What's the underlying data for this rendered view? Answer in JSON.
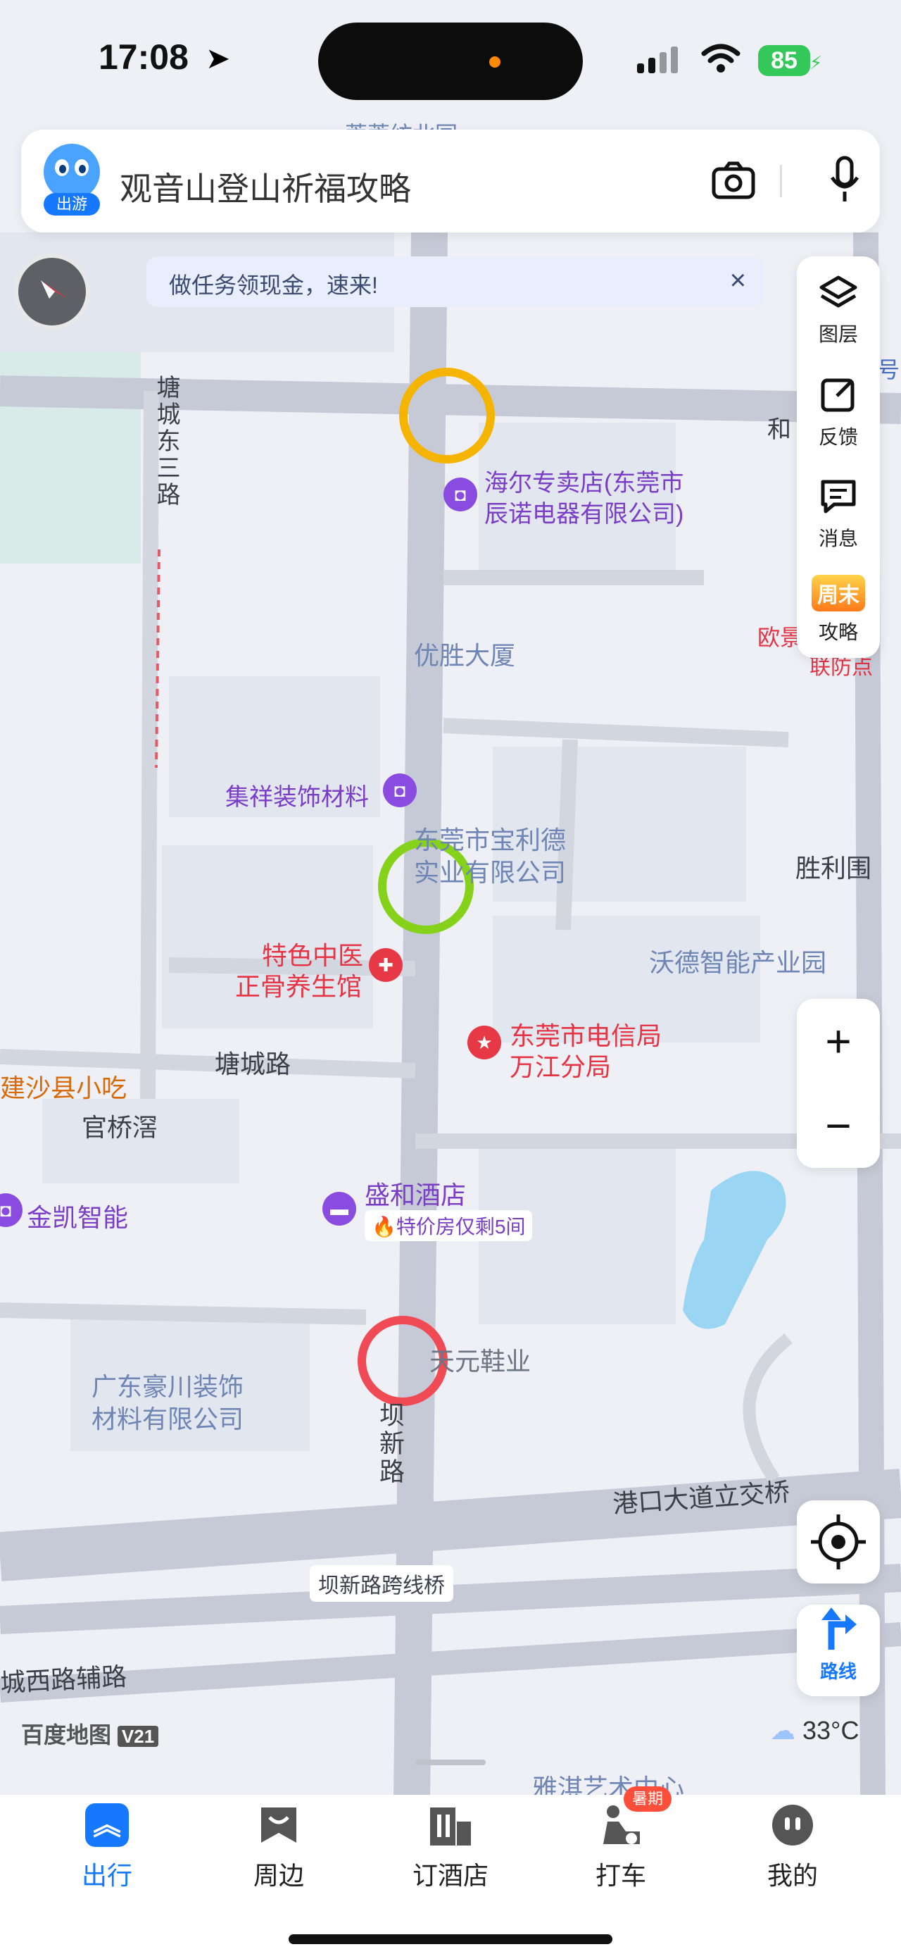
{
  "status_bar": {
    "time": "17:08",
    "battery": "85"
  },
  "search": {
    "badge": "出游",
    "query": "观音山登山祈福攻略"
  },
  "banner": {
    "text": "做任务领现金，速来!",
    "close": "×"
  },
  "panel": {
    "layers": "图层",
    "feedback": "反馈",
    "messages": "消息",
    "guide_badge": "周末",
    "guide": "攻略"
  },
  "zoom": {
    "plus": "+",
    "minus": "−"
  },
  "route": {
    "label": "路线"
  },
  "map": {
    "roads": {
      "tangcheng_east3": "塘城东三路",
      "tangcheng": "塘城路",
      "baxin": "坝新路",
      "gangkou": "港口大道立交桥",
      "baxin_bridge": "坝新路跨线桥",
      "chengxi": "城西路辅路"
    },
    "pois": {
      "haier": "海尔专卖店(东莞市辰诺电器有限公司)",
      "haier_line1": "海尔专卖店(东莞市",
      "haier_line2": "辰诺电器有限公司)",
      "yousheng": "优胜大厦",
      "jixiang": "集祥装饰材料",
      "baolide_line1": "东莞市宝利德",
      "baolide_line2": "实业有限公司",
      "tcm_line1": "特色中医",
      "tcm_line2": "正骨养生馆",
      "telecom_line1": "东莞市电信局",
      "telecom_line2": "万江分局",
      "wode": "沃德智能产业园",
      "shengli": "胜利围",
      "shaxian": "建沙县小吃",
      "guanqiao": "官桥滘",
      "jinkai": "金凯智能",
      "shenghe": "盛和酒店",
      "shenghe_deal": "特价房仅剩5间",
      "tianyuan": "天元鞋业",
      "haochuan_line1": "广东豪川装饰",
      "haochuan_line2": "材料有限公司",
      "ouo": "欧景",
      "lianfang": "联防点",
      "he": "和",
      "hao": "号",
      "yaqi": "雅淇艺术中心",
      "top_fragment": "莞莞纺北园"
    },
    "markers": {
      "yellow": "#f5b400",
      "green": "#86d21a",
      "red": "#f04b55"
    },
    "brand": "百度地图",
    "version": "V21",
    "temperature": "33°C"
  },
  "tabs": [
    {
      "label": "出行",
      "active": true
    },
    {
      "label": "周边",
      "active": false
    },
    {
      "label": "订酒店",
      "active": false
    },
    {
      "label": "打车",
      "active": false
    },
    {
      "label": "我的",
      "active": false
    }
  ],
  "taxi_badge": "暑期"
}
